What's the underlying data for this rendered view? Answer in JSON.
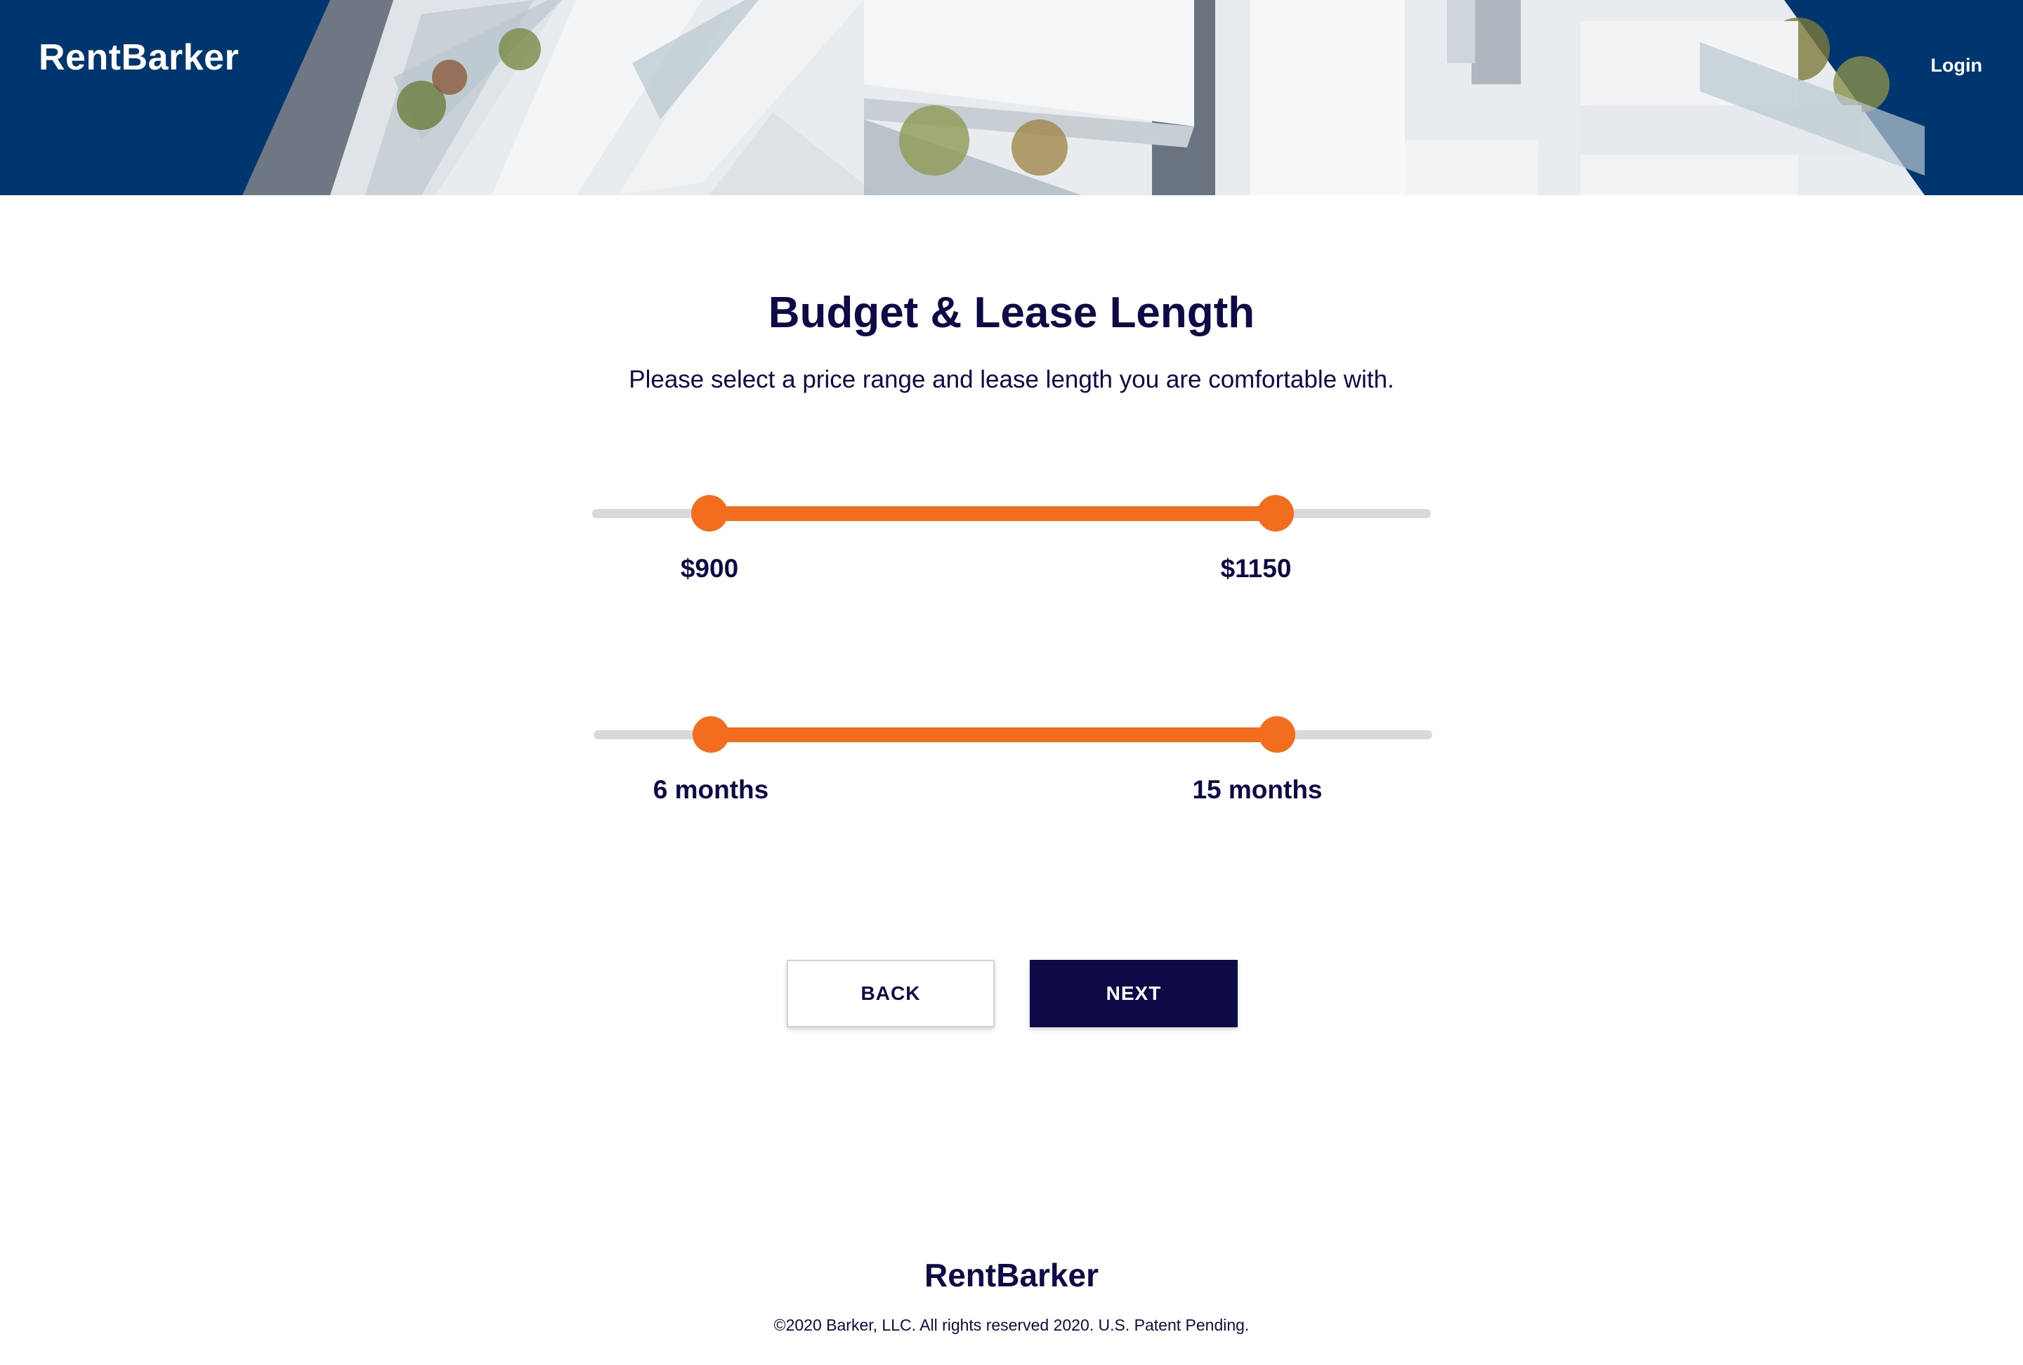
{
  "header": {
    "brand": "RentBarker",
    "login_label": "Login"
  },
  "main": {
    "title": "Budget & Lease Length",
    "subtitle": "Please select a price range and lease length you are comfortable with.",
    "price_slider": {
      "min_label": "$900",
      "max_label": "$1150",
      "low_fraction": 0.14,
      "high_fraction": 0.815
    },
    "lease_slider": {
      "min_label": "6 months",
      "max_label": "15 months",
      "low_fraction": 0.14,
      "high_fraction": 0.815
    }
  },
  "buttons": {
    "back_label": "BACK",
    "next_label": "NEXT"
  },
  "footer": {
    "brand": "RentBarker",
    "legal": "©2020 Barker, LLC. All rights reserved 2020. U.S. Patent Pending."
  },
  "colors": {
    "header_bg": "#003670",
    "accent": "#f36d1e",
    "navy": "#0d0a47",
    "track": "#d9d9d9"
  }
}
